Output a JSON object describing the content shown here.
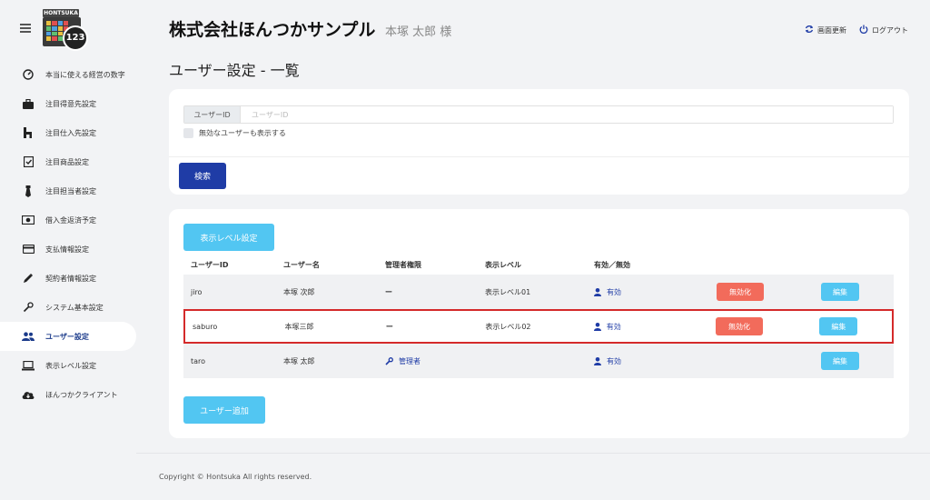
{
  "logo": {
    "brand": "HONTSUKA",
    "number": "123"
  },
  "sidebar": {
    "items": [
      {
        "label": "本当に使える経営の数字",
        "icon": "gauge-icon"
      },
      {
        "label": "注目得意先設定",
        "icon": "briefcase-icon"
      },
      {
        "label": "注目仕入先設定",
        "icon": "building-icon"
      },
      {
        "label": "注目商品設定",
        "icon": "checkbox-icon"
      },
      {
        "label": "注目担当者設定",
        "icon": "tie-icon"
      },
      {
        "label": "借入金返済予定",
        "icon": "money-icon"
      },
      {
        "label": "支払情報設定",
        "icon": "credit-card-icon"
      },
      {
        "label": "契約者情報設定",
        "icon": "pen-icon"
      },
      {
        "label": "システム基本設定",
        "icon": "wrench-icon"
      },
      {
        "label": "ユーザー設定",
        "icon": "users-icon",
        "active": true
      },
      {
        "label": "表示レベル設定",
        "icon": "laptop-icon"
      },
      {
        "label": "ほんつかクライアント",
        "icon": "cloud-download-icon"
      }
    ]
  },
  "header": {
    "company": "株式会社ほんつかサンプル",
    "user": "本塚 太郎 様",
    "refresh_label": "画面更新",
    "logout_label": "ログアウト"
  },
  "page_title": "ユーザー設定 - 一覧",
  "search": {
    "field_label": "ユーザーID",
    "placeholder": "ユーザーID",
    "value": "",
    "checkbox_label": "無効なユーザーも表示する",
    "button_label": "検索"
  },
  "list": {
    "level_button_label": "表示レベル設定",
    "add_button_label": "ユーザー追加",
    "columns": [
      "ユーザーID",
      "ユーザー名",
      "管理者権限",
      "表示レベル",
      "有効／無効"
    ],
    "rows": [
      {
        "id": "jiro",
        "name": "本塚 次郎",
        "admin": "ー",
        "level": "表示レベル01",
        "status": "有効",
        "disable_label": "無効化",
        "edit_label": "編集"
      },
      {
        "id": "saburo",
        "name": "本塚三郎",
        "admin": "ー",
        "level": "表示レベル02",
        "status": "有効",
        "disable_label": "無効化",
        "edit_label": "編集"
      },
      {
        "id": "taro",
        "name": "本塚 太郎",
        "admin": "管理者",
        "level": "",
        "status": "有効",
        "disable_label": "",
        "edit_label": "編集"
      }
    ]
  },
  "footer": "Copyright © Hontsuka All rights reserved.",
  "colors": {
    "primary": "#1f3ca6",
    "cyan": "#52c6f2",
    "danger": "#f26b5b",
    "highlight": "#d42a2a"
  }
}
